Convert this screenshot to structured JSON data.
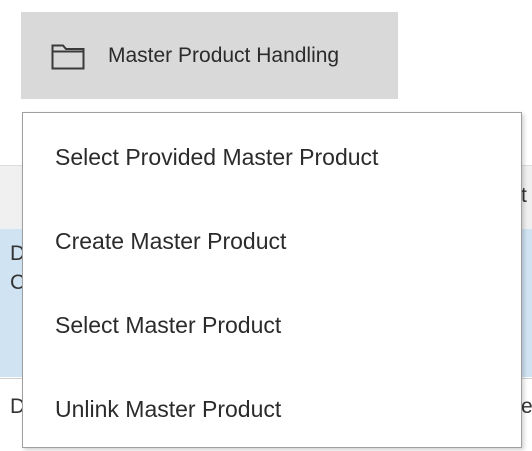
{
  "toolbar": {
    "master_product_handling": {
      "label": "Master Product Handling",
      "icon": "folder-icon"
    }
  },
  "menu": {
    "items": [
      {
        "label": "Select Provided Master Product"
      },
      {
        "label": "Create Master Product"
      },
      {
        "label": "Select Master Product"
      },
      {
        "label": "Unlink Master Product"
      }
    ]
  },
  "background": {
    "header_fragment": "t",
    "row1_line1": "D",
    "row1_line2": "C",
    "row2_line1": "D",
    "row2_right": "e"
  },
  "colors": {
    "button_hover": "#d9d9d9",
    "selected_row": "#cfe3f3",
    "menu_border": "#a0a0a0",
    "text": "#2b2b2b"
  }
}
